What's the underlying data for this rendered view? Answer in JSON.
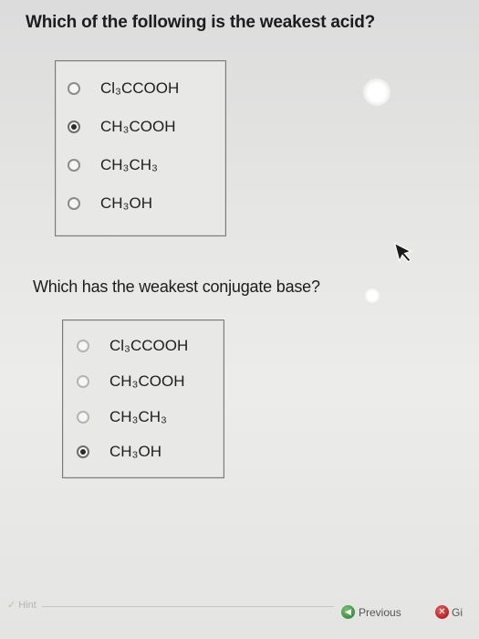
{
  "question1": {
    "title": "Which of the following is the weakest acid?",
    "options": [
      {
        "label": "Cl₃CCOOH",
        "selected": false
      },
      {
        "label": "CH₃COOH",
        "selected": true
      },
      {
        "label": "CH₃CH₃",
        "selected": false
      },
      {
        "label": "CH₃OH",
        "selected": false
      }
    ]
  },
  "question2": {
    "title": "Which has the weakest conjugate base?",
    "options": [
      {
        "label": "Cl₃CCOOH",
        "selected": false
      },
      {
        "label": "CH₃COOH",
        "selected": false
      },
      {
        "label": "CH₃CH₃",
        "selected": false
      },
      {
        "label": "CH₃OH",
        "selected": true
      }
    ]
  },
  "footer": {
    "hint_label": "Hint",
    "previous_label": "Previous",
    "give_up_label": "Gi"
  },
  "icons": {
    "previous": "back-arrow-icon",
    "give_up": "give-up-x-icon",
    "cursor": "mouse-pointer-icon"
  }
}
